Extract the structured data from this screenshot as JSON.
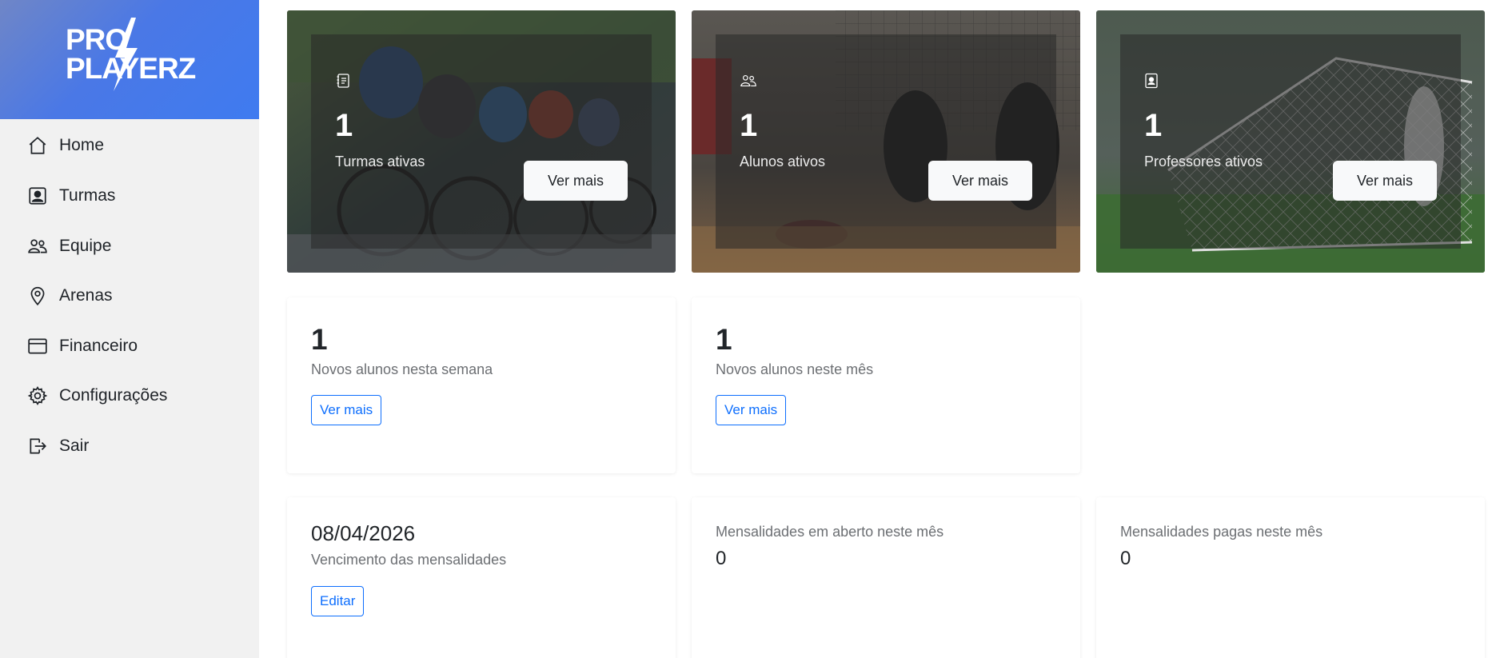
{
  "brand": {
    "logo_text": "PRO\nPLAYERZ"
  },
  "sidebar": {
    "items": [
      {
        "label": "Home",
        "icon": "home-icon"
      },
      {
        "label": "Turmas",
        "icon": "person-badge-icon"
      },
      {
        "label": "Equipe",
        "icon": "people-icon"
      },
      {
        "label": "Arenas",
        "icon": "location-pin-icon"
      },
      {
        "label": "Financeiro",
        "icon": "wallet-icon"
      },
      {
        "label": "Configurações",
        "icon": "gear-icon"
      },
      {
        "label": "Sair",
        "icon": "logout-icon"
      }
    ]
  },
  "summary_cards": [
    {
      "count": "1",
      "label": "Turmas ativas",
      "button": "Ver mais",
      "icon": "journal-list-icon"
    },
    {
      "count": "1",
      "label": "Alunos ativos",
      "button": "Ver mais",
      "icon": "people-icon"
    },
    {
      "count": "1",
      "label": "Professores ativos",
      "button": "Ver mais",
      "icon": "person-id-card-icon"
    }
  ],
  "new_students": [
    {
      "count": "1",
      "label": "Novos alunos nesta semana",
      "button": "Ver mais"
    },
    {
      "count": "1",
      "label": "Novos alunos neste mês",
      "button": "Ver mais"
    }
  ],
  "payments": {
    "due_date": "08/04/2026",
    "due_label": "Vencimento das mensalidades",
    "edit_button": "Editar",
    "open_label": "Mensalidades em aberto neste mês",
    "open_value": "0",
    "paid_label": "Mensalidades pagas neste mês",
    "paid_value": "0"
  },
  "colors": {
    "brand_blue": "#3f7bf0",
    "sidebar_bg": "#f1f1f1",
    "link_blue": "#0d6efd"
  }
}
